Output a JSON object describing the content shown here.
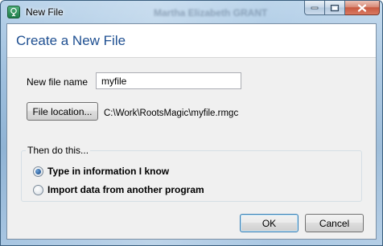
{
  "window": {
    "title": "New File",
    "background_text": "Martha Elizabeth GRANT",
    "caption_buttons": [
      "minimize-icon",
      "maximize-icon",
      "close-icon"
    ]
  },
  "header": {
    "title": "Create a New File"
  },
  "form": {
    "filename_label": "New file name",
    "filename_value": "myfile",
    "location_button_label": "File location...",
    "location_path": "C:\\Work\\RootsMagic\\myfile.rmgc"
  },
  "then_do": {
    "legend": "Then do this...",
    "options": [
      {
        "label": "Type in information I know",
        "selected": true
      },
      {
        "label": "Import data from another program",
        "selected": false
      }
    ]
  },
  "footer": {
    "ok_label": "OK",
    "cancel_label": "Cancel"
  }
}
